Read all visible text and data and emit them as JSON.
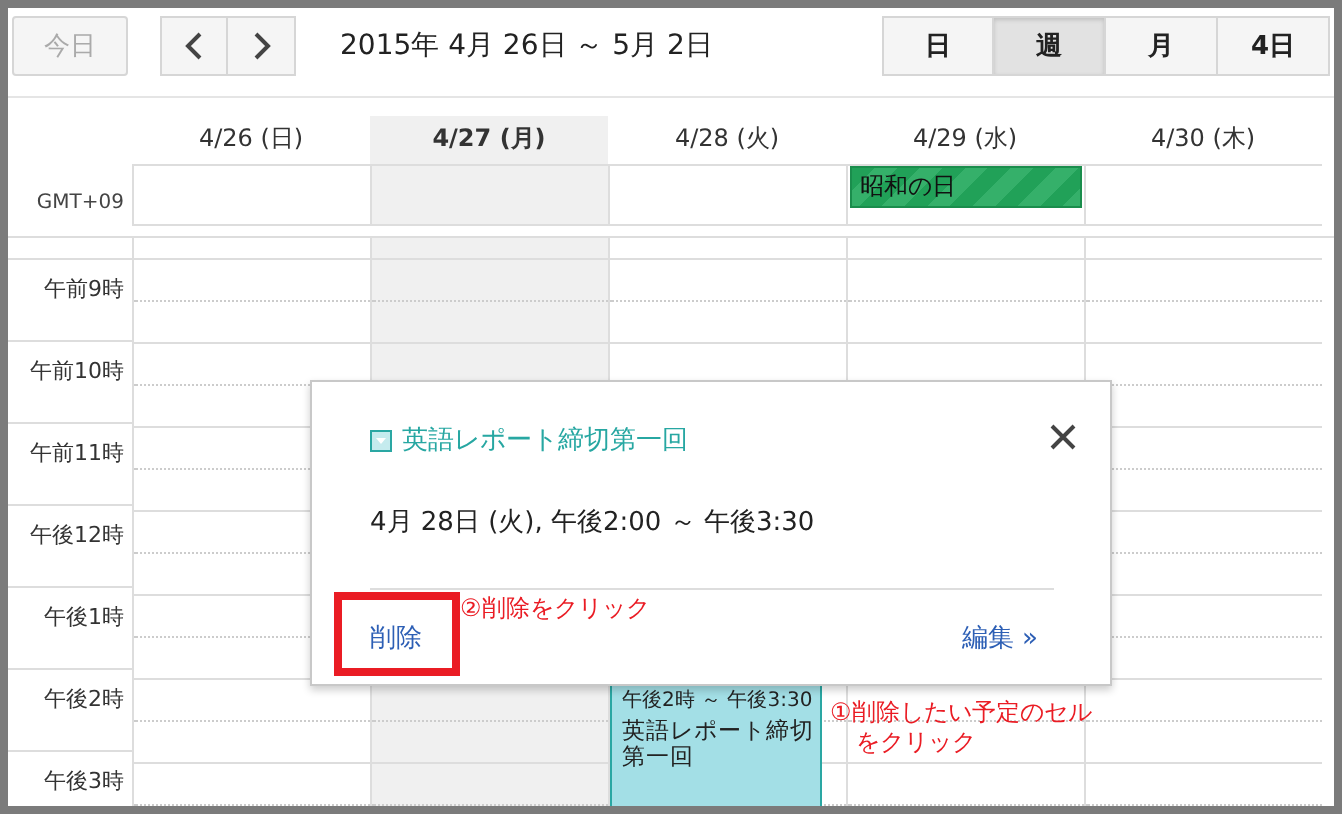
{
  "toolbar": {
    "today_button": {
      "label": "今日",
      "disabled": true
    },
    "date_range": "2015年 4月 26日 ～ 5月 2日",
    "view_tabs": [
      {
        "label": "日",
        "selected": false
      },
      {
        "label": "週",
        "selected": true
      },
      {
        "label": "月",
        "selected": false
      },
      {
        "label": "4日",
        "selected": false
      }
    ]
  },
  "timezone": "GMT+09",
  "days": [
    {
      "label": "4/26 (日)",
      "today": false
    },
    {
      "label": "4/27 (月)",
      "today": true
    },
    {
      "label": "4/28 (火)",
      "today": false,
      "events": [
        {
          "time": "午後2時 ～ 午後3:30",
          "title": "英語レポート締切第一回"
        }
      ]
    },
    {
      "label": "4/29 (水)",
      "today": false,
      "all_day_events": [
        {
          "title": "昭和の日"
        }
      ]
    },
    {
      "label": "4/30 (木)",
      "today": false
    }
  ],
  "hours": [
    "午前9時",
    "午前10時",
    "午前11時",
    "午後12時",
    "午後1時",
    "午後2時",
    "午後3時"
  ],
  "popup": {
    "title": "英語レポート締切第一回",
    "when": "4月 28日 (火), 午後2:00 ～ 午後3:30",
    "delete_link": "削除",
    "edit_link": "編集 »"
  },
  "annotations": [
    {
      "lines": [
        "②削除をクリック"
      ]
    },
    {
      "lines": [
        "①削除したい予定のセル",
        "をクリック"
      ]
    }
  ]
}
